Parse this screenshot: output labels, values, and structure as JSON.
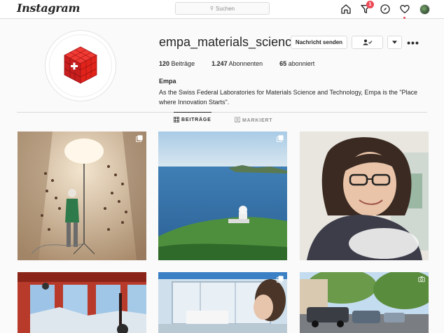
{
  "header": {
    "logo_text": "Instagram",
    "search_placeholder": "Suchen",
    "search_icon": "search-icon",
    "icons": [
      "home-icon",
      "filter-icon",
      "compass-icon",
      "heart-icon",
      "avatar"
    ],
    "activity_badge": "1"
  },
  "profile": {
    "username": "empa_materials_science",
    "message_button": "Nachricht senden",
    "follow_icon": "person-check-icon",
    "dropdown_icon": "chevron-down-icon",
    "more_label": "•••",
    "stats": {
      "posts_count": "120",
      "posts_label": "Beiträge",
      "followers_count": "1.247",
      "followers_label": "Abonnenten",
      "following_count": "65",
      "following_label": "abonniert"
    },
    "full_name": "Empa",
    "bio": "As the Swiss Federal Laboratories for Materials Science and Technology, Empa is the \"Place where Innovation Starts\"."
  },
  "tabs": [
    {
      "label": "BEITRÄGE",
      "icon": "grid-icon",
      "active": true
    },
    {
      "label": "MARKIERT",
      "icon": "tag-icon",
      "active": false
    }
  ],
  "colors": {
    "accent_red": "#ed4956",
    "border": "#dbdbdb",
    "text": "#262626",
    "muted": "#8e8e8e",
    "logo_red": "#e2231a"
  },
  "posts": [
    {
      "id": "post-1",
      "multi": true
    },
    {
      "id": "post-2",
      "multi": true
    },
    {
      "id": "post-3",
      "multi": false
    },
    {
      "id": "post-4",
      "multi": false
    },
    {
      "id": "post-5",
      "multi": true
    },
    {
      "id": "post-6",
      "multi": true
    }
  ]
}
